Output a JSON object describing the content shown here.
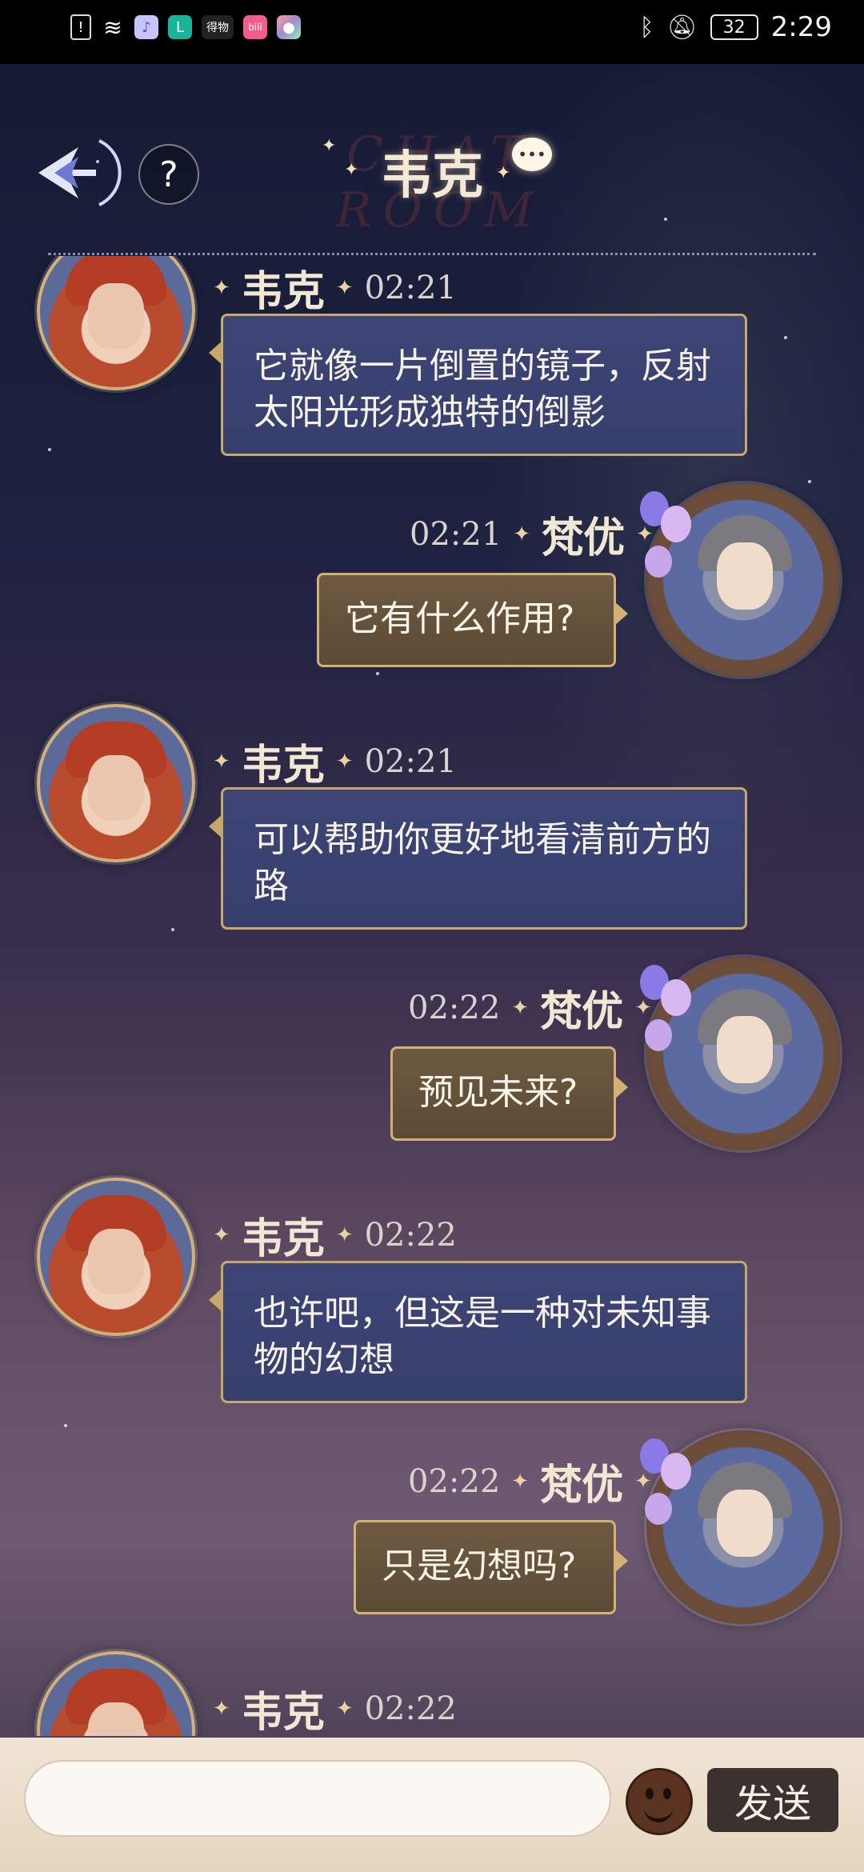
{
  "status_bar": {
    "time": "2:29",
    "battery": "32",
    "left_icons": [
      "alert-icon",
      "wifi-icon",
      "music-app-icon",
      "app-l-icon",
      "dewu-app-icon",
      "bilibili-app-icon",
      "app-colorful-icon"
    ],
    "right_icons": [
      "bluetooth-icon",
      "mute-icon"
    ]
  },
  "header": {
    "title": "韦克",
    "title_background_text": "CHAT ROOM",
    "help_label": "?"
  },
  "messages": [
    {
      "side": "left",
      "sender": "韦克",
      "time": "02:21",
      "text_line1": "它就像一片倒置的镜子，反射",
      "text_line2": "太阳光形成独特的倒影"
    },
    {
      "side": "right",
      "sender": "梵优",
      "time": "02:21",
      "text": "它有什么作用?"
    },
    {
      "side": "left",
      "sender": "韦克",
      "time": "02:21",
      "text_line1": "可以帮助你更好地看清前方的",
      "text_line2": "路"
    },
    {
      "side": "right",
      "sender": "梵优",
      "time": "02:22",
      "text": "预见未来?"
    },
    {
      "side": "left",
      "sender": "韦克",
      "time": "02:22",
      "text_line1": "也许吧，但这是一种对未知事",
      "text_line2": "物的幻想"
    },
    {
      "side": "right",
      "sender": "梵优",
      "time": "02:22",
      "text": "只是幻想吗?"
    },
    {
      "side": "left",
      "sender": "韦克",
      "time": "02:22"
    }
  ],
  "input_bar": {
    "placeholder": "",
    "send_label": "发送"
  },
  "colors": {
    "left_bubble": "#3c4575",
    "right_bubble": "#6e5a40",
    "bubble_border": "#c5a86a",
    "send_button": "#3b3230",
    "input_bar": "#efe4d4"
  }
}
